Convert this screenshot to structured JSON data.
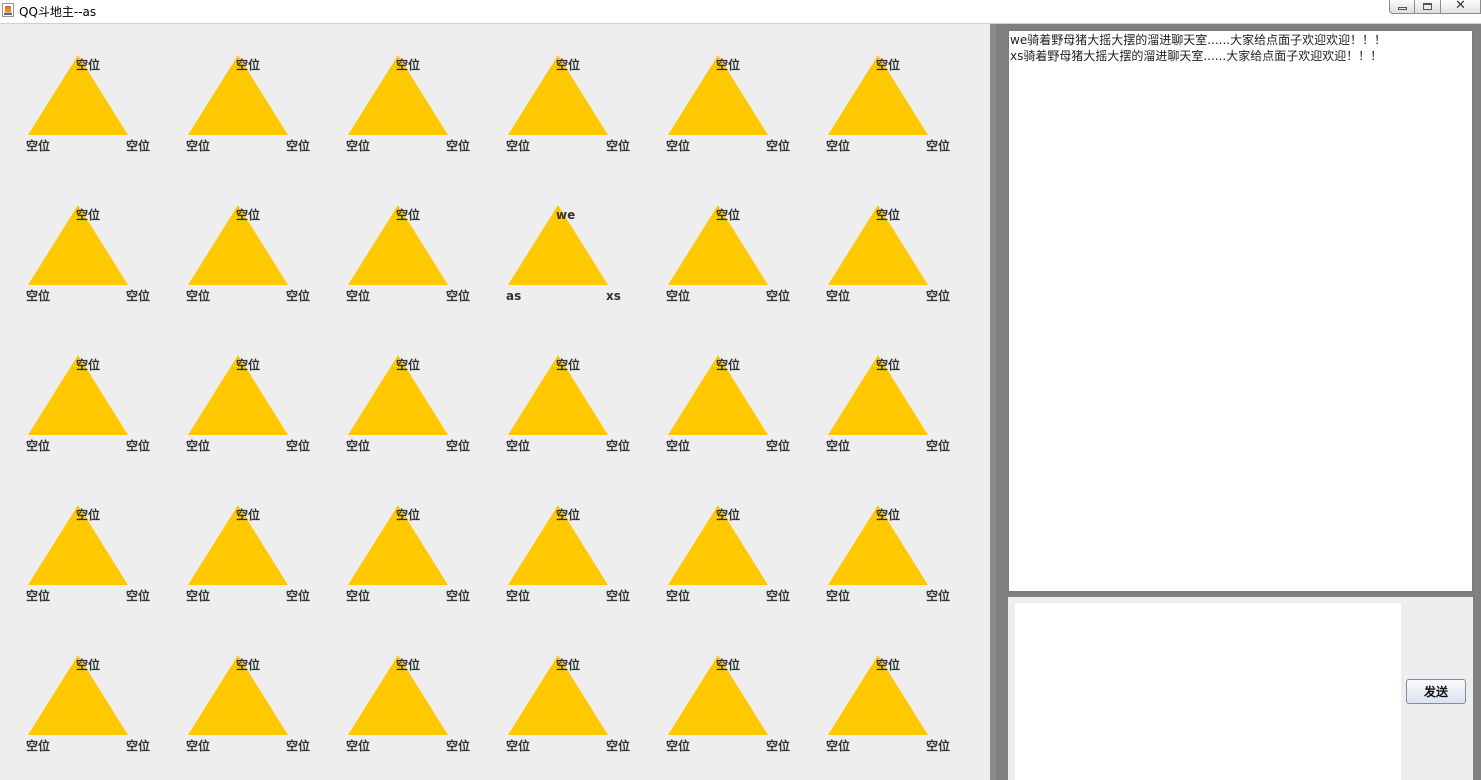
{
  "window": {
    "title": "QQ斗地主--as",
    "icon": "java-cup-icon"
  },
  "colors": {
    "table": "#ffc800",
    "background": "#eeeeee",
    "divider": "#8a8a8a"
  },
  "tables": [
    {
      "top": "空位",
      "left": "空位",
      "right": "空位"
    },
    {
      "top": "空位",
      "left": "空位",
      "right": "空位"
    },
    {
      "top": "空位",
      "left": "空位",
      "right": "空位"
    },
    {
      "top": "空位",
      "left": "空位",
      "right": "空位"
    },
    {
      "top": "空位",
      "left": "空位",
      "right": "空位"
    },
    {
      "top": "空位",
      "left": "空位",
      "right": "空位"
    },
    {
      "top": "空位",
      "left": "空位",
      "right": "空位"
    },
    {
      "top": "空位",
      "left": "空位",
      "right": "空位"
    },
    {
      "top": "空位",
      "left": "空位",
      "right": "空位"
    },
    {
      "top": "we",
      "left": "as",
      "right": "xs"
    },
    {
      "top": "空位",
      "left": "空位",
      "right": "空位"
    },
    {
      "top": "空位",
      "left": "空位",
      "right": "空位"
    },
    {
      "top": "空位",
      "left": "空位",
      "right": "空位"
    },
    {
      "top": "空位",
      "left": "空位",
      "right": "空位"
    },
    {
      "top": "空位",
      "left": "空位",
      "right": "空位"
    },
    {
      "top": "空位",
      "left": "空位",
      "right": "空位"
    },
    {
      "top": "空位",
      "left": "空位",
      "right": "空位"
    },
    {
      "top": "空位",
      "left": "空位",
      "right": "空位"
    },
    {
      "top": "空位",
      "left": "空位",
      "right": "空位"
    },
    {
      "top": "空位",
      "left": "空位",
      "right": "空位"
    },
    {
      "top": "空位",
      "left": "空位",
      "right": "空位"
    },
    {
      "top": "空位",
      "left": "空位",
      "right": "空位"
    },
    {
      "top": "空位",
      "left": "空位",
      "right": "空位"
    },
    {
      "top": "空位",
      "left": "空位",
      "right": "空位"
    },
    {
      "top": "空位",
      "left": "空位",
      "right": "空位"
    },
    {
      "top": "空位",
      "left": "空位",
      "right": "空位"
    },
    {
      "top": "空位",
      "left": "空位",
      "right": "空位"
    },
    {
      "top": "空位",
      "left": "空位",
      "right": "空位"
    },
    {
      "top": "空位",
      "left": "空位",
      "right": "空位"
    },
    {
      "top": "空位",
      "left": "空位",
      "right": "空位"
    }
  ],
  "chat": {
    "messages": [
      "we骑着野母猪大摇大摆的溜进聊天室......大家给点面子欢迎欢迎！！！",
      "xs骑着野母猪大摇大摆的溜进聊天室......大家给点面子欢迎欢迎！！！"
    ],
    "input_value": "",
    "send_label": "发送"
  }
}
